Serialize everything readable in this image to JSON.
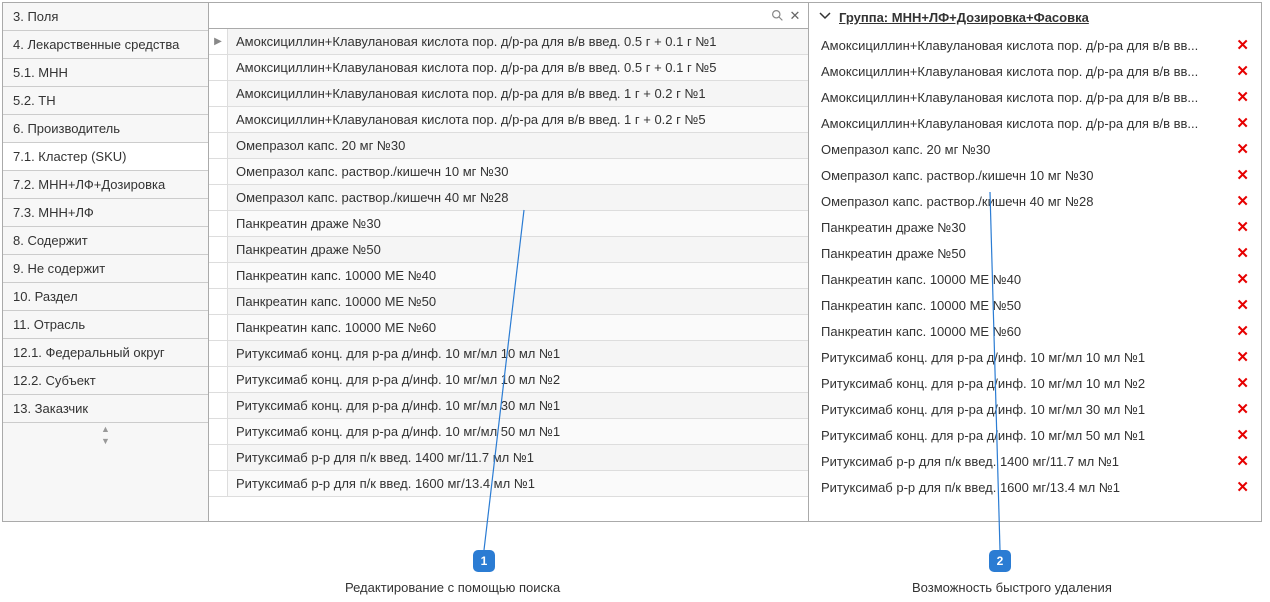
{
  "sidebar": {
    "items": [
      {
        "label": "3. Поля",
        "active": false
      },
      {
        "label": "4. Лекарственные средства",
        "active": false
      },
      {
        "label": "5.1. МНН",
        "active": false
      },
      {
        "label": "5.2. ТН",
        "active": false
      },
      {
        "label": "6. Производитель",
        "active": false
      },
      {
        "label": "7.1. Кластер (SKU)",
        "active": true
      },
      {
        "label": "7.2. МНН+ЛФ+Дозировка",
        "active": false
      },
      {
        "label": "7.3. МНН+ЛФ",
        "active": false
      },
      {
        "label": "8. Содержит",
        "active": false
      },
      {
        "label": "9. Не содержит",
        "active": false
      },
      {
        "label": "10. Раздел",
        "active": false
      },
      {
        "label": "11. Отрасль",
        "active": false
      },
      {
        "label": "12.1. Федеральный округ",
        "active": false
      },
      {
        "label": "12.2. Субъект",
        "active": false
      },
      {
        "label": "13. Заказчик",
        "active": false
      }
    ]
  },
  "search": {
    "placeholder": ""
  },
  "center": {
    "items": [
      "Амоксициллин+Клавулановая кислота пор. д/р-ра для в/в введ. 0.5 г + 0.1 г №1",
      "Амоксициллин+Клавулановая кислота пор. д/р-ра для в/в введ. 0.5 г + 0.1 г №5",
      "Амоксициллин+Клавулановая кислота пор. д/р-ра для в/в введ. 1 г + 0.2 г №1",
      "Амоксициллин+Клавулановая кислота пор. д/р-ра для в/в введ. 1 г + 0.2 г №5",
      "Омепразол капс. 20 мг №30",
      "Омепразол капс. раствор./кишечн 10 мг  №30",
      "Омепразол капс. раствор./кишечн 40 мг №28",
      "Панкреатин драже  №30",
      "Панкреатин драже  №50",
      "Панкреатин капс. 10000 МЕ  №40",
      "Панкреатин капс. 10000 МЕ  №50",
      "Панкреатин капс. 10000 МЕ  №60",
      "Ритуксимаб конц. для р-ра д/инф. 10 мг/мл 10 мл  №1",
      "Ритуксимаб конц. для р-ра д/инф. 10 мг/мл 10 мл  №2",
      "Ритуксимаб конц. для р-ра д/инф. 10 мг/мл 30 мл  №1",
      "Ритуксимаб конц. для р-ра д/инф. 10 мг/мл 50 мл  №1",
      "Ритуксимаб р-р для п/к введ. 1400 мг/11.7 мл №1",
      "Ритуксимаб р-р для п/к введ. 1600 мг/13.4 мл №1"
    ]
  },
  "right": {
    "group_title": "Группа: МНН+ЛФ+Дозировка+Фасовка",
    "items": [
      "Амоксициллин+Клавулановая кислота пор. д/р-ра для в/в вв...",
      "Амоксициллин+Клавулановая кислота пор. д/р-ра для в/в вв...",
      "Амоксициллин+Клавулановая кислота пор. д/р-ра для в/в вв...",
      "Амоксициллин+Клавулановая кислота пор. д/р-ра для в/в вв...",
      "Омепразол капс. 20 мг №30",
      "Омепразол капс. раствор./кишечн 10 мг  №30",
      "Омепразол капс. раствор./кишечн 40 мг №28",
      "Панкреатин драже  №30",
      "Панкреатин драже  №50",
      "Панкреатин капс. 10000 МЕ  №40",
      "Панкреатин капс. 10000 МЕ  №50",
      "Панкреатин капс. 10000 МЕ  №60",
      "Ритуксимаб конц. для р-ра д/инф. 10 мг/мл 10 мл  №1",
      "Ритуксимаб конц. для р-ра д/инф. 10 мг/мл 10 мл  №2",
      "Ритуксимаб конц. для р-ра д/инф. 10 мг/мл 30 мл  №1",
      "Ритуксимаб конц. для р-ра д/инф. 10 мг/мл 50 мл  №1",
      "Ритуксимаб р-р для п/к введ. 1400 мг/11.7 мл №1",
      "Ритуксимаб р-р для п/к введ. 1600 мг/13.4 мл №1"
    ]
  },
  "annotations": {
    "badge1": "1",
    "caption1": "Редактирование с помощью поиска",
    "badge2": "2",
    "caption2": "Возможность быстрого удаления"
  }
}
